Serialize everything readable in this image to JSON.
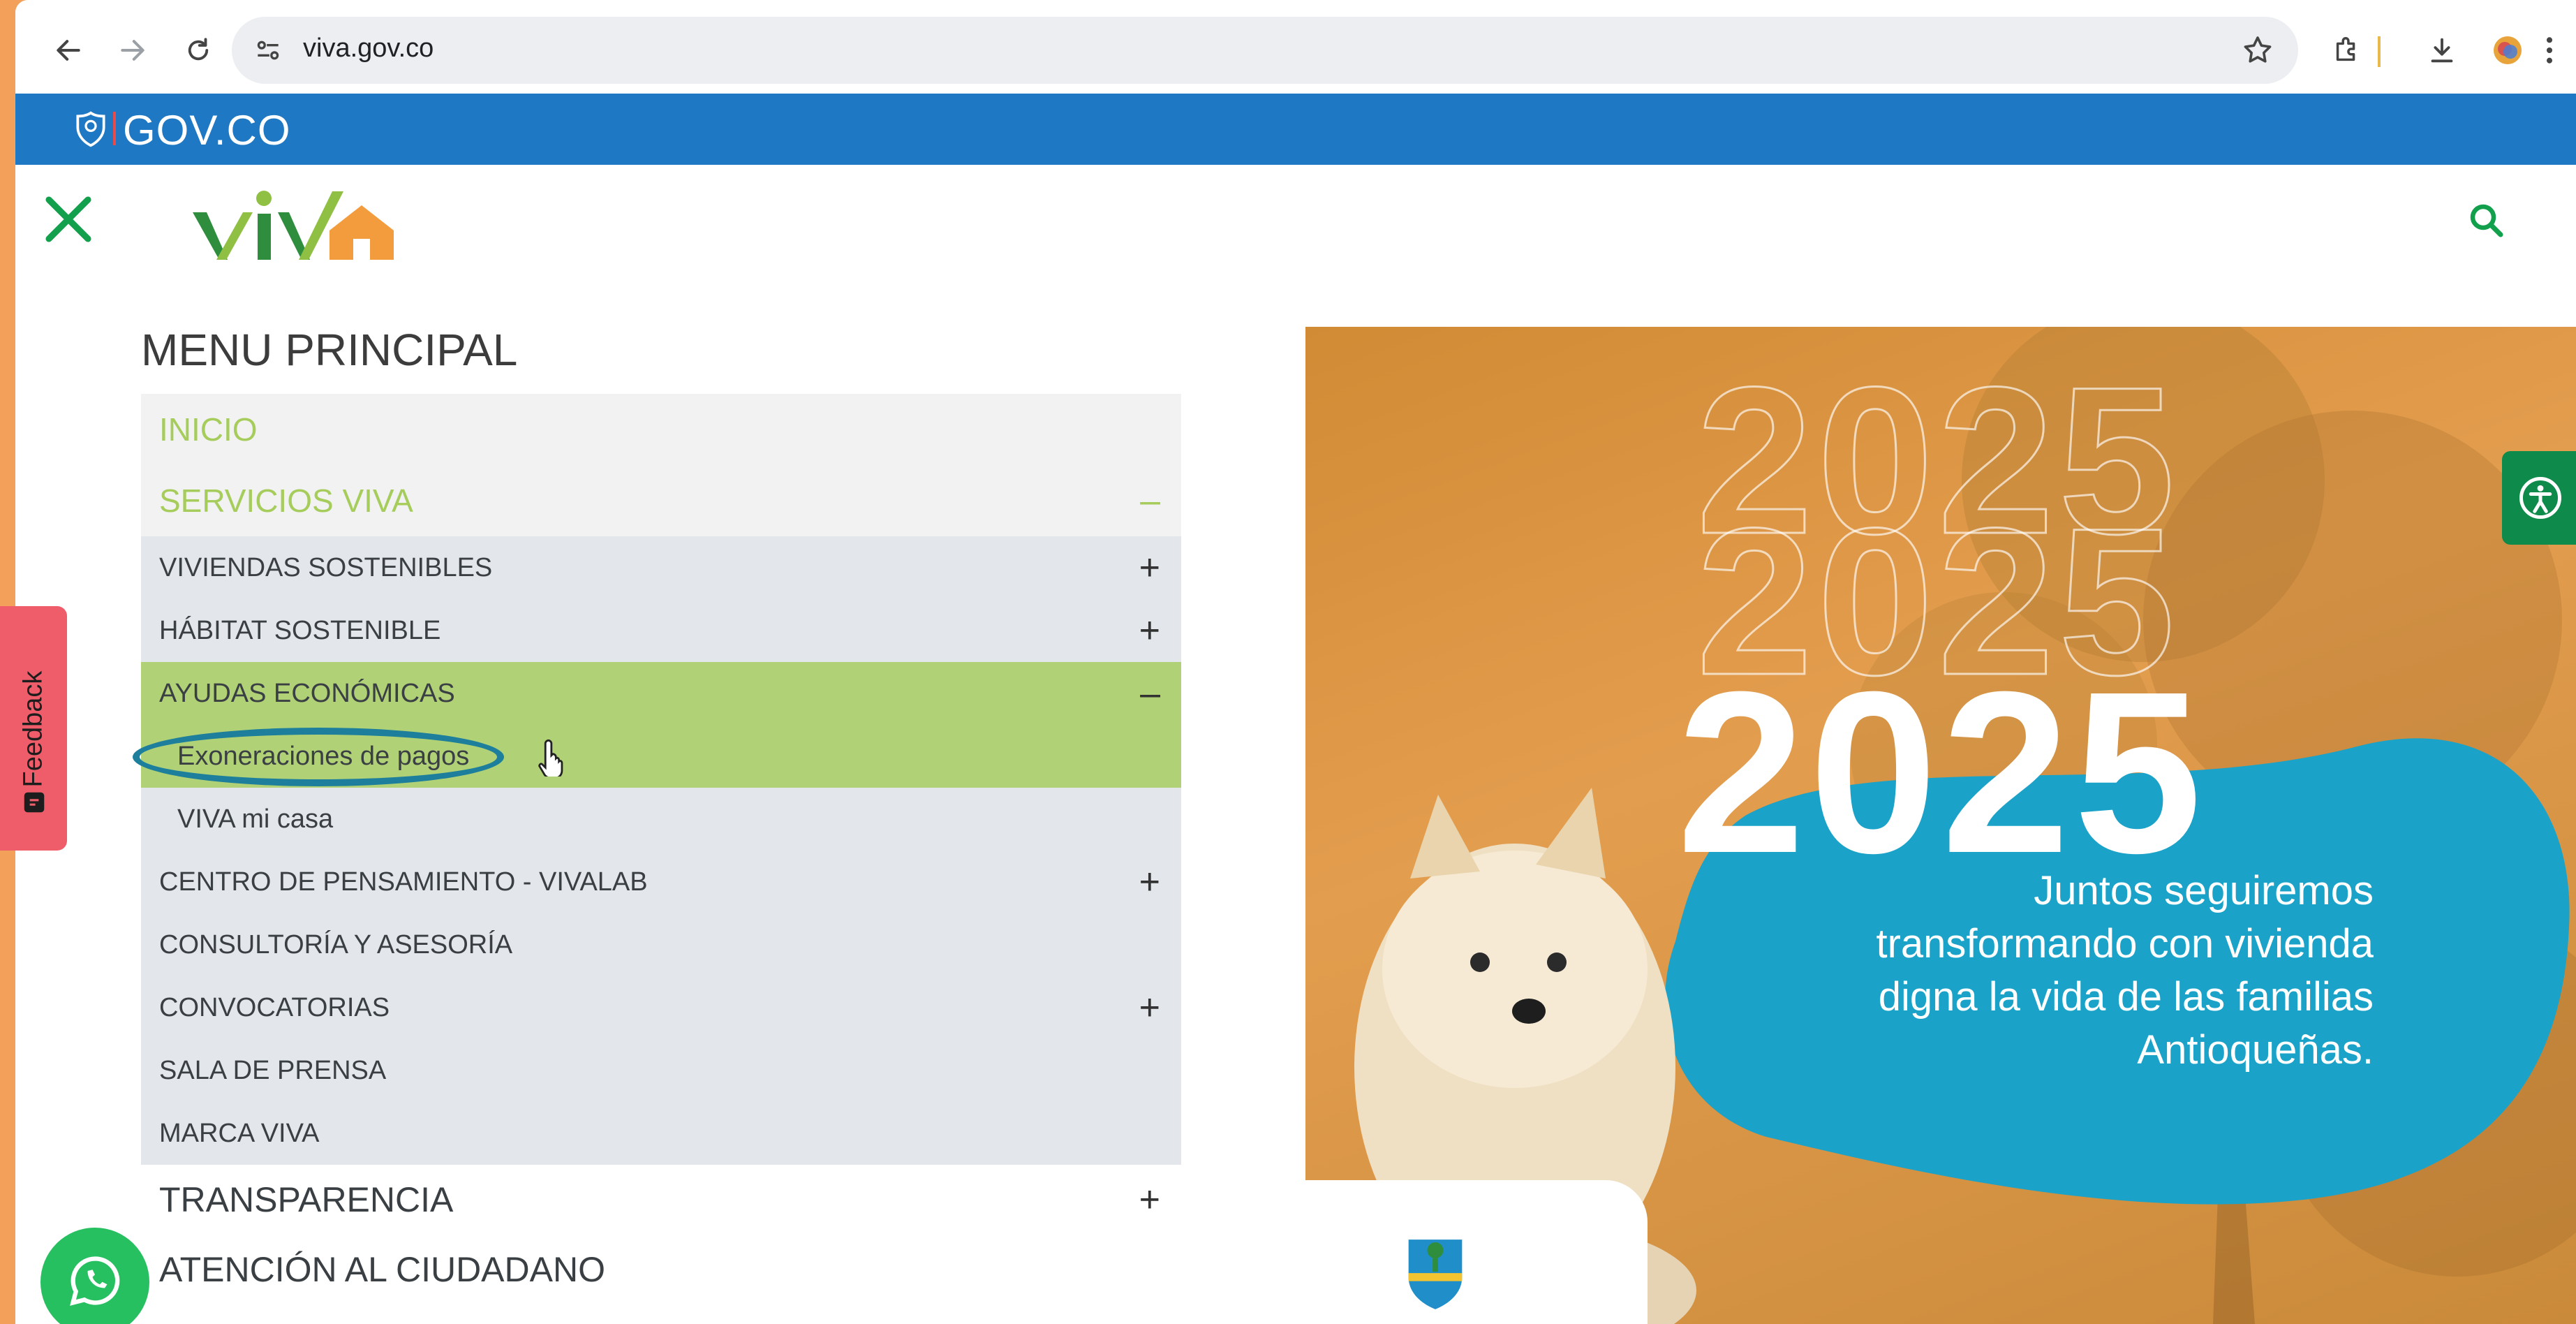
{
  "browser": {
    "url": "viva.gov.co"
  },
  "gov_bar": {
    "label": "GOV.CO"
  },
  "site": {
    "logo_text": "viva"
  },
  "menu": {
    "title": "MENU PRINCIPAL",
    "items": [
      {
        "label": "INICIO",
        "level": "top",
        "sign": ""
      },
      {
        "label": "SERVICIOS VIVA",
        "level": "top",
        "sign": "–"
      },
      {
        "label": "VIVIENDAS SOSTENIBLES",
        "level": "sub",
        "sign": "+"
      },
      {
        "label": "HÁBITAT SOSTENIBLE",
        "level": "sub",
        "sign": "+"
      },
      {
        "label": "AYUDAS ECONÓMICAS",
        "level": "sub",
        "sign": "–",
        "active": true
      },
      {
        "label": "Exoneraciones de pagos",
        "level": "child",
        "active": true
      },
      {
        "label": "VIVA mi casa",
        "level": "child"
      },
      {
        "label": "CENTRO DE PENSAMIENTO - VIVALAB",
        "level": "sub",
        "sign": "+"
      },
      {
        "label": "CONSULTORÍA Y ASESORÍA",
        "level": "sub",
        "sign": ""
      },
      {
        "label": "CONVOCATORIAS",
        "level": "sub",
        "sign": "+"
      },
      {
        "label": "SALA DE PRENSA",
        "level": "sub",
        "sign": ""
      },
      {
        "label": "MARCA VIVA",
        "level": "sub",
        "sign": ""
      },
      {
        "label": "TRANSPARENCIA",
        "level": "main",
        "sign": "+"
      },
      {
        "label": "ATENCIÓN AL CIUDADANO",
        "level": "main",
        "sign": ""
      }
    ]
  },
  "hero": {
    "year_outline_1": "2025",
    "year_outline_2": "2025",
    "year_main": "2025",
    "text_lines": [
      "Juntos seguiremos",
      "transformando con vivienda",
      "digna la vida de las familias",
      "Antioqueñas."
    ]
  },
  "feedback": {
    "label": "Feedback"
  },
  "colors": {
    "gov_blue": "#1f78c4",
    "viva_green": "#a6cd5c",
    "active_green": "#b1d176",
    "sub_gray": "#e3e7eb",
    "hero_blue": "#1aa2c8",
    "feedback_red": "#ef5d6a"
  }
}
